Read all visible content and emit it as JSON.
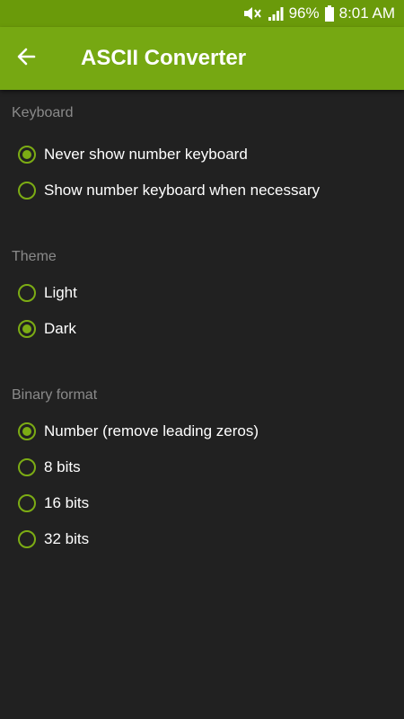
{
  "status_bar": {
    "battery": "96%",
    "time": "8:01 AM",
    "icons": [
      "mute-icon",
      "signal-icon",
      "battery-icon"
    ]
  },
  "app_bar": {
    "title": "ASCII Converter",
    "back_icon": "arrow-back-icon"
  },
  "colors": {
    "status_bar": "#6a9a0a",
    "app_bar": "#76a812",
    "accent": "#7cac14",
    "background": "#212121",
    "section_header": "#8a8a8a"
  },
  "sections": [
    {
      "header": "Keyboard",
      "options": [
        {
          "label": "Never show number keyboard",
          "checked": true
        },
        {
          "label": "Show number keyboard when necessary",
          "checked": false
        }
      ]
    },
    {
      "header": "Theme",
      "options": [
        {
          "label": "Light",
          "checked": false
        },
        {
          "label": "Dark",
          "checked": true
        }
      ]
    },
    {
      "header": "Binary format",
      "options": [
        {
          "label": "Number (remove leading zeros)",
          "checked": true
        },
        {
          "label": "8 bits",
          "checked": false
        },
        {
          "label": "16 bits",
          "checked": false
        },
        {
          "label": "32 bits",
          "checked": false
        }
      ]
    }
  ]
}
